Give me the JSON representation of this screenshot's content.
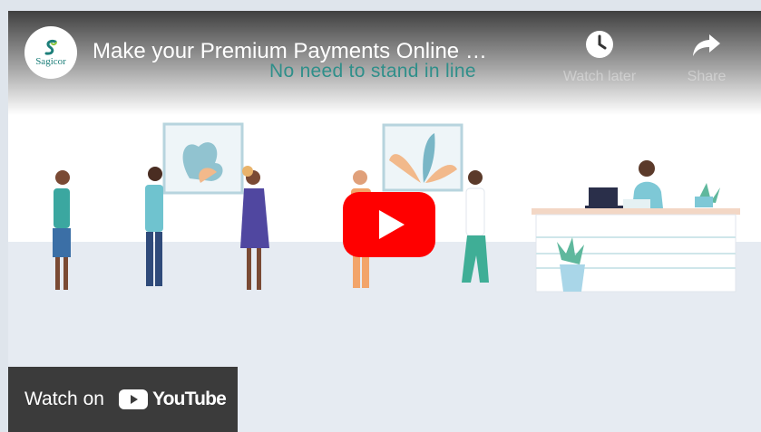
{
  "player": {
    "title": "Make your Premium Payments Online …",
    "scene_caption": "No need to stand in line",
    "channel": {
      "logo_text": "Sagicor",
      "brand_color": "#1d7f7a"
    },
    "controls": {
      "watch_later_label": "Watch later",
      "watch_later_icon": "clock-icon",
      "share_label": "Share",
      "share_icon": "share-arrow-icon"
    },
    "play_button": {
      "icon": "youtube-play-icon",
      "color": "#ff0000"
    },
    "watch_on": {
      "label": "Watch on",
      "brand": "YouTube"
    }
  }
}
